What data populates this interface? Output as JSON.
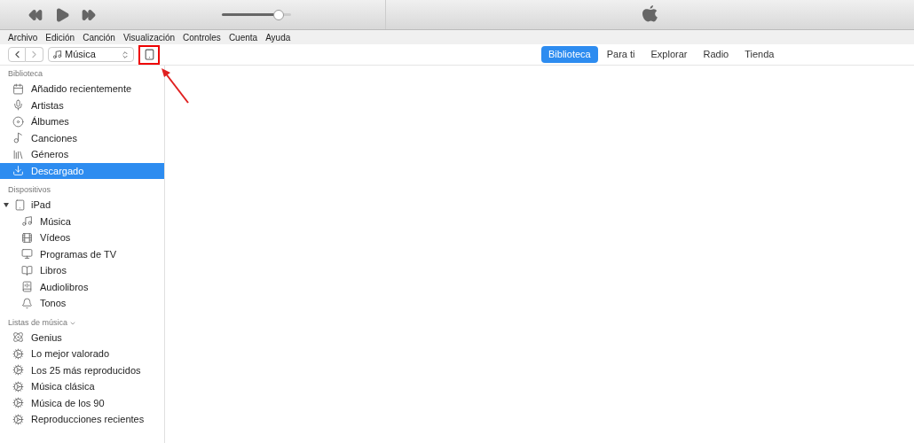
{
  "player": {
    "volume": {
      "level": 0.82
    }
  },
  "menu": [
    "Archivo",
    "Edición",
    "Canción",
    "Visualización",
    "Controles",
    "Cuenta",
    "Ayuda"
  ],
  "toolbar": {
    "media_picker": "Música",
    "device_button": {
      "highlighted": true
    }
  },
  "tabs": [
    {
      "label": "Biblioteca",
      "selected": true
    },
    {
      "label": "Para ti",
      "selected": false
    },
    {
      "label": "Explorar",
      "selected": false
    },
    {
      "label": "Radio",
      "selected": false
    },
    {
      "label": "Tienda",
      "selected": false
    }
  ],
  "sidebar": {
    "sections": [
      {
        "title": "Biblioteca",
        "items": [
          {
            "label": "Añadido recientemente",
            "selected": false
          },
          {
            "label": "Artistas",
            "selected": false
          },
          {
            "label": "Álbumes",
            "selected": false
          },
          {
            "label": "Canciones",
            "selected": false
          },
          {
            "label": "Géneros",
            "selected": false
          },
          {
            "label": "Descargado",
            "selected": true
          }
        ]
      },
      {
        "title": "Dispositivos",
        "items": [
          {
            "label": "iPad",
            "selected": false,
            "expanded": true,
            "children": [
              {
                "label": "Música",
                "selected": false
              },
              {
                "label": "Vídeos",
                "selected": false
              },
              {
                "label": "Programas de TV",
                "selected": false
              },
              {
                "label": "Libros",
                "selected": false
              },
              {
                "label": "Audiolibros",
                "selected": false
              },
              {
                "label": "Tonos",
                "selected": false
              }
            ]
          }
        ]
      },
      {
        "title": "Listas de música",
        "collapsible": true,
        "items": [
          {
            "label": "Genius",
            "selected": false
          },
          {
            "label": "Lo mejor valorado",
            "selected": false
          },
          {
            "label": "Los 25 más reproducidos",
            "selected": false
          },
          {
            "label": "Música clásica",
            "selected": false
          },
          {
            "label": "Música de los 90",
            "selected": false
          },
          {
            "label": "Reproducciones recientes",
            "selected": false
          }
        ]
      }
    ]
  }
}
